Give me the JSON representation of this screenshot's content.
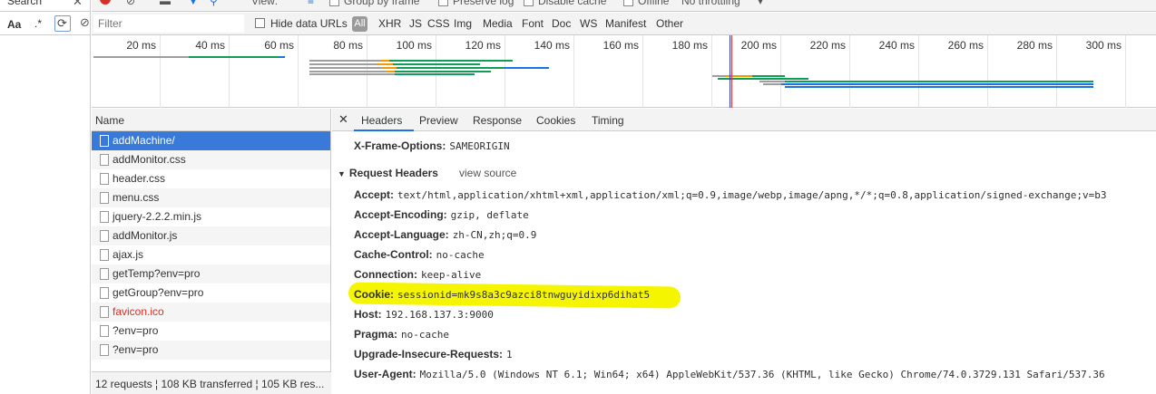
{
  "search_panel": {
    "tab": "Search",
    "case_label": "Aa",
    "regex_label": ".*"
  },
  "toolbar": {
    "view_label": "View:",
    "group_by_frame": "Group by frame",
    "preserve_log": "Preserve log",
    "disable_cache": "Disable cache",
    "offline": "Offline",
    "throttling": "No throttling"
  },
  "filter": {
    "placeholder": "Filter",
    "hide_data_urls": "Hide data URLs",
    "all": "All",
    "types": [
      "XHR",
      "JS",
      "CSS",
      "Img",
      "Media",
      "Font",
      "Doc",
      "WS",
      "Manifest",
      "Other"
    ]
  },
  "timeline": {
    "ticks": [
      "20 ms",
      "40 ms",
      "60 ms",
      "80 ms",
      "100 ms",
      "120 ms",
      "140 ms",
      "160 ms",
      "180 ms",
      "200 ms",
      "220 ms",
      "240 ms",
      "260 ms",
      "280 ms",
      "300 ms"
    ],
    "colors": {
      "waiting": "#0f9d58",
      "download": "#1a73e8",
      "queue": "#9e9e9e",
      "dns": "#f29900",
      "dom_content_loaded": "#1a3ed8",
      "load": "#d93025"
    }
  },
  "requests": {
    "header": "Name",
    "items": [
      {
        "name": "addMachine/",
        "selected": true,
        "error": false
      },
      {
        "name": "addMonitor.css",
        "selected": false,
        "error": false
      },
      {
        "name": "header.css",
        "selected": false,
        "error": false
      },
      {
        "name": "menu.css",
        "selected": false,
        "error": false
      },
      {
        "name": "jquery-2.2.2.min.js",
        "selected": false,
        "error": false
      },
      {
        "name": "addMonitor.js",
        "selected": false,
        "error": false
      },
      {
        "name": "ajax.js",
        "selected": false,
        "error": false
      },
      {
        "name": "getTemp?env=pro",
        "selected": false,
        "error": false
      },
      {
        "name": "getGroup?env=pro",
        "selected": false,
        "error": false
      },
      {
        "name": "favicon.ico",
        "selected": false,
        "error": true
      },
      {
        "name": "?env=pro",
        "selected": false,
        "error": false
      },
      {
        "name": "?env=pro",
        "selected": false,
        "error": false
      }
    ],
    "status": "12 requests ¦ 108 KB transferred ¦ 105 KB res..."
  },
  "details": {
    "tabs": [
      "Headers",
      "Preview",
      "Response",
      "Cookies",
      "Timing"
    ],
    "active_tab": "Headers",
    "x_frame": {
      "key": "X-Frame-Options:",
      "value": "SAMEORIGIN"
    },
    "section_title": "Request Headers",
    "view_source": "view source",
    "headers": [
      {
        "key": "Accept:",
        "value": "text/html,application/xhtml+xml,application/xml;q=0.9,image/webp,image/apng,*/*;q=0.8,application/signed-exchange;v=b3"
      },
      {
        "key": "Accept-Encoding:",
        "value": "gzip, deflate"
      },
      {
        "key": "Accept-Language:",
        "value": "zh-CN,zh;q=0.9"
      },
      {
        "key": "Cache-Control:",
        "value": "no-cache"
      },
      {
        "key": "Connection:",
        "value": "keep-alive"
      },
      {
        "key": "Cookie:",
        "value": "sessionid=mk9s8a3c9azci8tnwguyidixp6dihat5"
      },
      {
        "key": "Host:",
        "value": "192.168.137.3:9000"
      },
      {
        "key": "Pragma:",
        "value": "no-cache"
      },
      {
        "key": "Upgrade-Insecure-Requests:",
        "value": "1"
      },
      {
        "key": "User-Agent:",
        "value": "Mozilla/5.0 (Windows NT 6.1; Win64; x64) AppleWebKit/537.36 (KHTML, like Gecko) Chrome/74.0.3729.131 Safari/537.36"
      }
    ],
    "highlight_color": "#f5f500"
  }
}
